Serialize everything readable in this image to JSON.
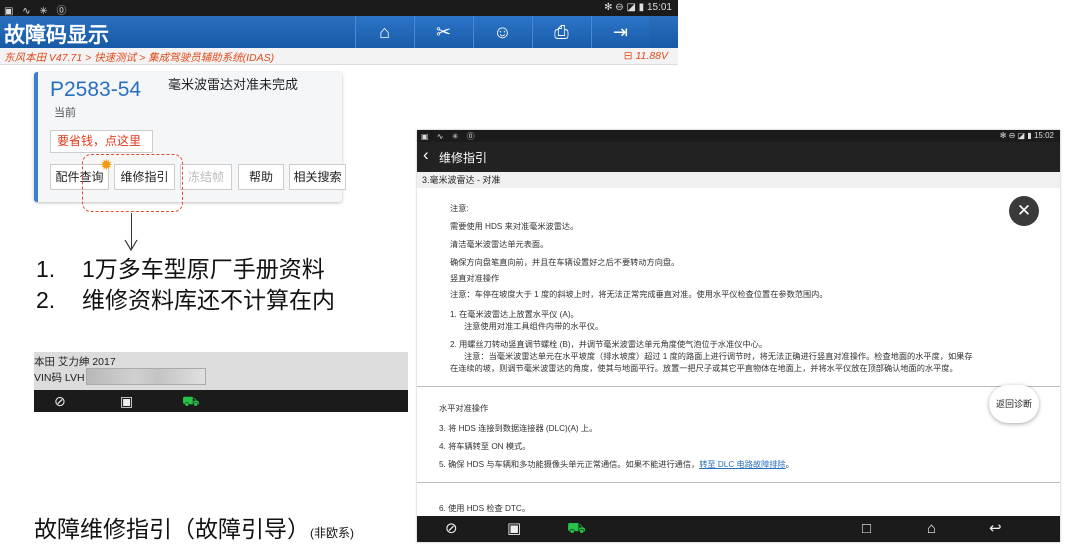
{
  "left": {
    "status": {
      "left_icons": "▣ ∿ ✳ ⓪",
      "right": "✻ ⊖ ◪ ▮ 15:01"
    },
    "title": "故障码显示",
    "toolbar": [
      {
        "icon": "home-icon",
        "glyph": "⌂"
      },
      {
        "icon": "tools-icon",
        "glyph": "✂"
      },
      {
        "icon": "user-icon",
        "glyph": "☺"
      },
      {
        "icon": "print-icon",
        "glyph": "⎙"
      },
      {
        "icon": "exit-icon",
        "glyph": "⇥"
      }
    ],
    "breadcrumb": "东风本田 V47.71 > 快速测试 > 集成驾驶员辅助系统(IDAS)",
    "voltage": "⊟ 11.88V",
    "dtc": {
      "code": "P2583-54",
      "description": "毫米波雷达对准未完成",
      "state": "当前",
      "save_label": "要省钱，点这里",
      "buttons": [
        {
          "label": "配件查询",
          "enabled": true
        },
        {
          "label": "维修指引",
          "enabled": true
        },
        {
          "label": "冻结帧",
          "enabled": false
        },
        {
          "label": "帮助",
          "enabled": true
        },
        {
          "label": "相关搜索",
          "enabled": true
        }
      ]
    },
    "notes": [
      {
        "num": "1.",
        "text": "1万多车型原厂手册资料"
      },
      {
        "num": "2.",
        "text": "维修资料库还不计算在内"
      }
    ],
    "vehicle": {
      "model": "本田 艾力绅 2017",
      "vin_label": "VIN码 LVH"
    },
    "caption": {
      "main": "故障维修指引（故障引导）",
      "small": "(非欧系)"
    }
  },
  "right": {
    "status": {
      "left_icons": "▣ ∿ ✳ ⓪",
      "right": "✻ ⊖ ◪ ▮ 15:02"
    },
    "title": "维修指引",
    "section": "3.毫米波雷达 - 对准",
    "lines": [
      "注意:",
      "需要使用 HDS 来对准毫米波雷达。",
      "清洁毫米波雷达单元表面。",
      "确保方向盘笔直向前，并且在车辆设置好之后不要转动方向盘。",
      "竖直对准操作",
      "注意：车停在坡度大于 1 度的斜坡上时，将无法正常完成垂直对准。使用水平仪检查位置在参数范围内。",
      "1.  在毫米波雷达上放置水平仪 (A)。",
      "注意使用对准工具组件内带的水平仪。",
      "2.  用螺丝刀转动竖直调节螺栓 (B)，并调节毫米波雷达单元角度使气泡位于水准仪中心。",
      "注意：当毫米波雷达单元在水平坡度（排水坡度）超过 1 度的路面上进行调节时，将无法正确进行竖直对准操作。检查地面的水平度，如果存",
      "在连续的坡，则调节毫米波雷达的角度，使其与地面平行。放置一把尺子或其它平直物体在地面上，并将水平仪放在顶部确认地面的水平度。"
    ],
    "horiz_title": "水平对准操作",
    "steps": [
      "3.  将 HDS 连接到数据连接器 (DLC)(A) 上。",
      "4.  将车辆转至 ON 模式。",
      "5.  确保 HDS 与车辆和多功能摄像头单元正常通信。如果不能进行通信，"
    ],
    "step5_link": "转至 DLC 电路故障排除",
    "step5_end": "。",
    "step6": "6.  使用 HDS 检查 DTC。",
    "return_label": "返回诊断"
  }
}
